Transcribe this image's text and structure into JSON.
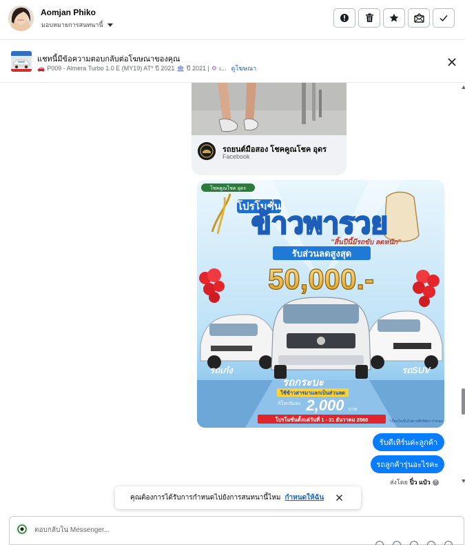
{
  "header": {
    "user_name": "Aomjan Phiko",
    "assign_label": "มอบหมายการสนทนานี้",
    "actions": [
      {
        "icon": "alert-icon"
      },
      {
        "icon": "trash-icon"
      },
      {
        "icon": "star-icon"
      },
      {
        "icon": "mark-unread-icon"
      },
      {
        "icon": "check-icon"
      }
    ]
  },
  "ad": {
    "title": "แชทนี้มีข้อความตอบกลับต่อโฆษณาของคุณ",
    "car_icon": "🚗",
    "model": "P009 - Almera Turbo 1.0 E (MY19) AT* ปี 2021",
    "bank_icon": "🏛",
    "year": "ปี 2021 |",
    "gear_icon": "⚙",
    "more": "เ...",
    "view_ad": "ดูโฆษณา"
  },
  "messages": {
    "shared_post": {
      "page_name": "รถยนต์มือสอง โชคคูณโชค อุดร",
      "source": "Facebook"
    },
    "promo_image": {
      "header_tag": "โชคคูณโชค อุดร",
      "heading": "โปรโมชั่น",
      "big_title": "ข้าวพารวย",
      "tagline": "\"สิ้นปีนี้มีรถขับ ลดหนัก\"",
      "discount_label": "รับส่วนลดสูงสุด",
      "discount_value": "50,000.-",
      "left_label": "รถเก๋ง",
      "center_label": "รถกระบะ",
      "right_label": "รถSUV",
      "rice_note": "ใช้ข้าวสารมาแลกเป็นส่วนลด",
      "per_kg": "กิโลกรัมละ",
      "price": "2,000",
      "baht": "บาท",
      "period": "โปรโมชั่นตั้งแต่วันที่ 1 - 31 ธันวาคม 2568",
      "footnote": "*เงื่อนไขเป็นไปตามที่บริษัทฯ กำหนด"
    },
    "replies": [
      "รับดีเทิร์นค่ะลูกค้า",
      "รถลูกค้ารุ่นอะไรคะ"
    ],
    "sent_by_prefix": "ส่งโดย",
    "sent_by_name": "ปิ๋ว แป๋ว",
    "sent_by_help": "?"
  },
  "snackbar": {
    "text": "คุณต้องการได้รับการกำหนดไปยังการสนทนานี้ไหม",
    "action": "กำหนดให้ฉัน"
  },
  "composer": {
    "placeholder": "ตอบกลับใน Messenger..."
  },
  "colors": {
    "bubble": "#0a7cff",
    "link": "#1a66c2",
    "promo_gold": "#f6b21b",
    "promo_blue": "#1f79d6"
  }
}
